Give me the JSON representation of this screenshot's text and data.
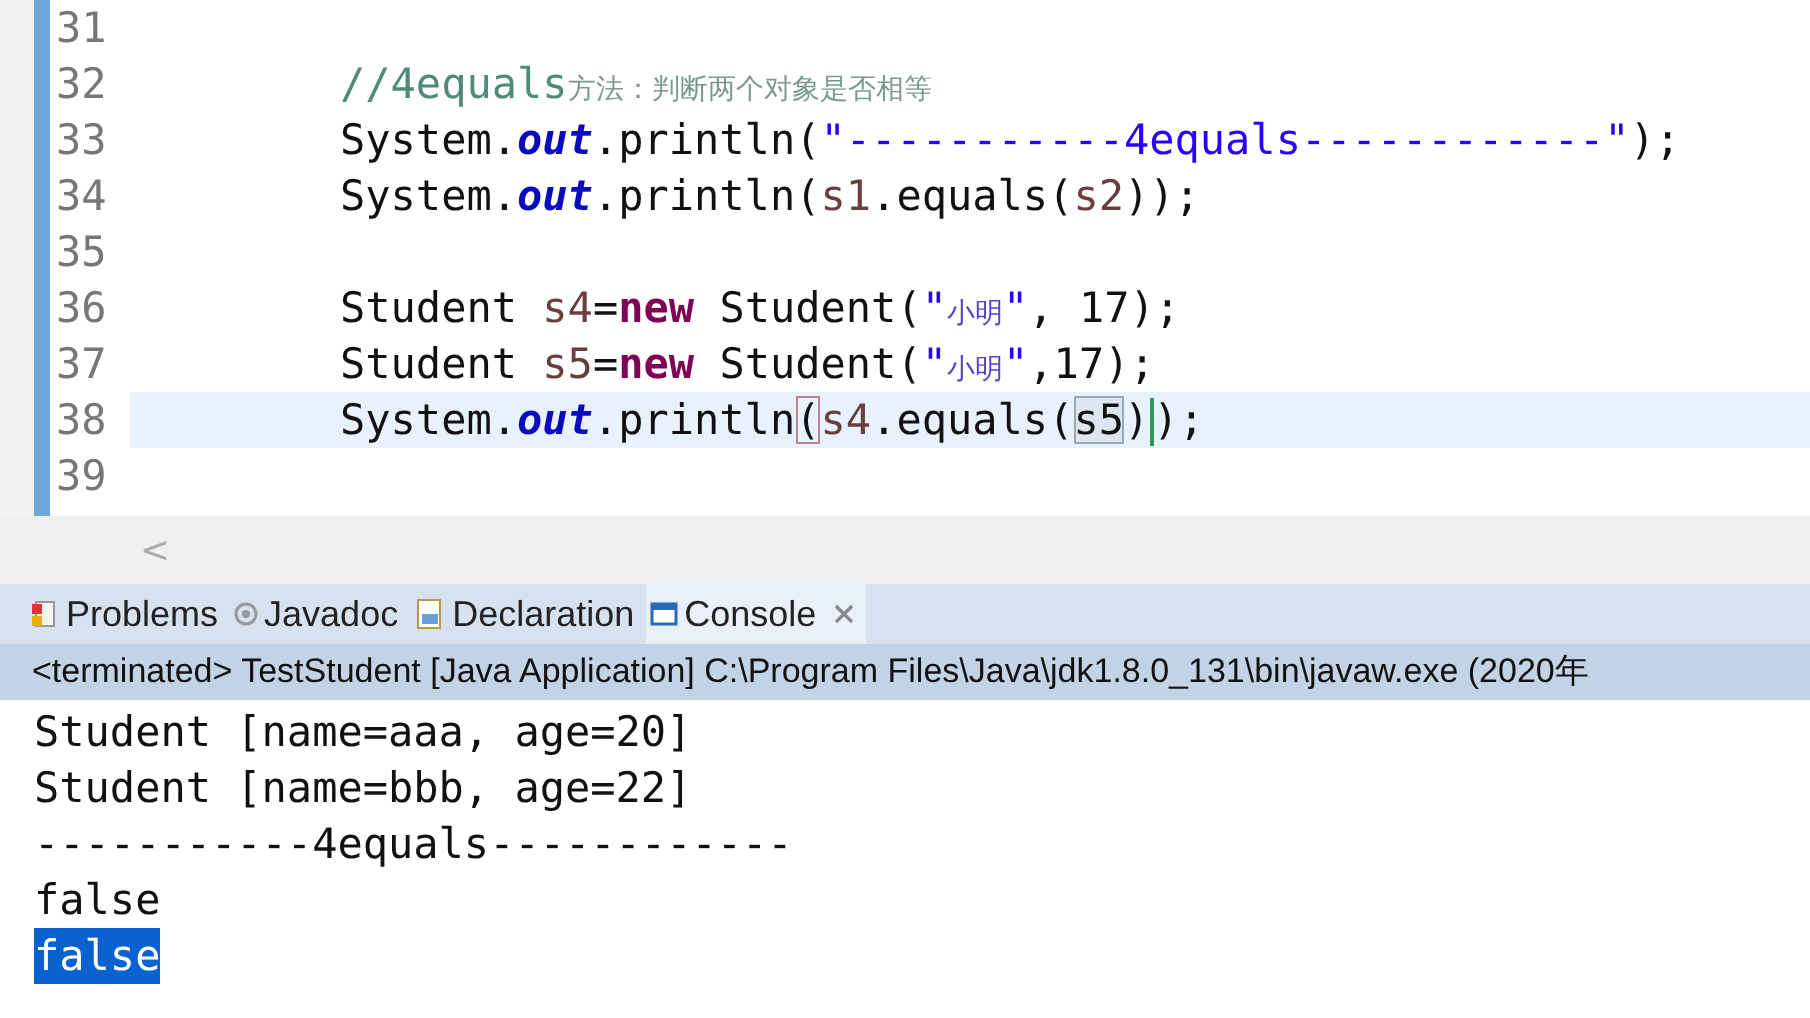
{
  "editor": {
    "lines": [
      {
        "number": "31",
        "current": false
      },
      {
        "number": "32",
        "current": false,
        "tokens": [
          {
            "text": "//4equals",
            "kind": "comment"
          },
          {
            "text": "方法：判断两个对象是否相等",
            "kind": "comment-cjk"
          }
        ]
      },
      {
        "number": "33",
        "current": false,
        "tokens": [
          {
            "text": "System.",
            "kind": "plain"
          },
          {
            "text": "out",
            "kind": "field"
          },
          {
            "text": ".println(",
            "kind": "plain"
          },
          {
            "text": "\"-----------4equals------------\"",
            "kind": "string"
          },
          {
            "text": ");",
            "kind": "plain"
          }
        ]
      },
      {
        "number": "34",
        "current": false,
        "tokens": [
          {
            "text": "System.",
            "kind": "plain"
          },
          {
            "text": "out",
            "kind": "field"
          },
          {
            "text": ".println(",
            "kind": "plain"
          },
          {
            "text": "s1",
            "kind": "local"
          },
          {
            "text": ".equals(",
            "kind": "plain"
          },
          {
            "text": "s2",
            "kind": "local"
          },
          {
            "text": "));",
            "kind": "plain"
          }
        ]
      },
      {
        "number": "35",
        "current": false
      },
      {
        "number": "36",
        "current": false,
        "tokens": [
          {
            "text": "Student ",
            "kind": "plain"
          },
          {
            "text": "s4",
            "kind": "local"
          },
          {
            "text": "=",
            "kind": "plain"
          },
          {
            "text": "new",
            "kind": "keyword"
          },
          {
            "text": " Student(",
            "kind": "plain"
          },
          {
            "text": "\"",
            "kind": "string"
          },
          {
            "text": "小明",
            "kind": "string-cjk"
          },
          {
            "text": "\"",
            "kind": "string"
          },
          {
            "text": ", 17);",
            "kind": "plain"
          }
        ]
      },
      {
        "number": "37",
        "current": false,
        "tokens": [
          {
            "text": "Student ",
            "kind": "plain"
          },
          {
            "text": "s5",
            "kind": "local"
          },
          {
            "text": "=",
            "kind": "plain"
          },
          {
            "text": "new",
            "kind": "keyword"
          },
          {
            "text": " Student(",
            "kind": "plain"
          },
          {
            "text": "\"",
            "kind": "string"
          },
          {
            "text": "小明",
            "kind": "string-cjk"
          },
          {
            "text": "\"",
            "kind": "string"
          },
          {
            "text": ",17);",
            "kind": "plain"
          }
        ]
      },
      {
        "number": "38",
        "current": true,
        "tokens": [
          {
            "text": "System.",
            "kind": "plain"
          },
          {
            "text": "out",
            "kind": "field"
          },
          {
            "text": ".println",
            "kind": "plain"
          },
          {
            "text": "(",
            "kind": "matched-bracket"
          },
          {
            "text": "s4",
            "kind": "local"
          },
          {
            "text": ".equals(",
            "kind": "plain"
          },
          {
            "text": "s5",
            "kind": "occurrence"
          },
          {
            "text": ")",
            "kind": "plain"
          },
          {
            "text": ")",
            "kind": "plain",
            "caret_before": true
          },
          {
            "text": ";",
            "kind": "plain"
          }
        ]
      },
      {
        "number": "39",
        "current": false
      }
    ],
    "scroll_left": "<"
  },
  "tabs": [
    {
      "label": "Problems",
      "kind": "problems",
      "selected": false
    },
    {
      "label": "Javadoc",
      "kind": "javadoc",
      "selected": false
    },
    {
      "label": "Declaration",
      "kind": "declaration",
      "selected": false
    },
    {
      "label": "Console",
      "kind": "console",
      "selected": true,
      "closable": true
    }
  ],
  "console": {
    "header": "<terminated> TestStudent [Java Application] C:\\Program Files\\Java\\jdk1.8.0_131\\bin\\javaw.exe (2020年",
    "lines": [
      {
        "text": "Student [name=aaa, age=20]",
        "selected": false
      },
      {
        "text": "Student [name=bbb, age=22]",
        "selected": false
      },
      {
        "text": "-----------4equals------------",
        "selected": false
      },
      {
        "text": "false",
        "selected": false
      },
      {
        "text": "false",
        "selected": true
      }
    ]
  }
}
